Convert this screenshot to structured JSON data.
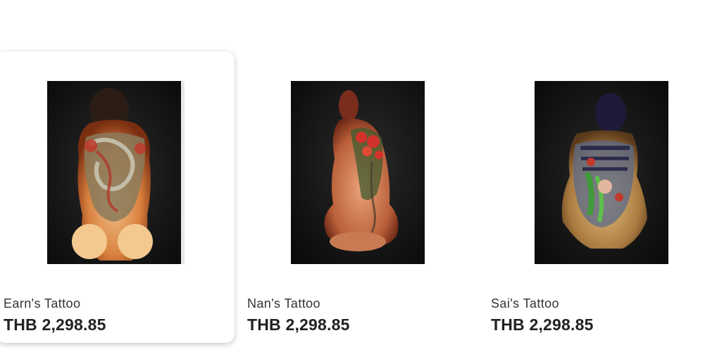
{
  "products": [
    {
      "title": "Earn's Tattoo",
      "price": "THB 2,298.85",
      "image_subject": "tattooed back, seated figure, dragon back-piece",
      "hovered": true
    },
    {
      "title": "Nan's Tattoo",
      "price": "THB 2,298.85",
      "image_subject": "tattooed back, kneeling figure, red flowers back-piece",
      "hovered": false
    },
    {
      "title": "Sai's Tattoo",
      "price": "THB 2,298.85",
      "image_subject": "tattooed back, seated figure, geisha and leaves back-piece",
      "hovered": false
    }
  ],
  "colors": {
    "poster_background": "#141414",
    "title_text": "#333333",
    "price_text": "#222222"
  }
}
